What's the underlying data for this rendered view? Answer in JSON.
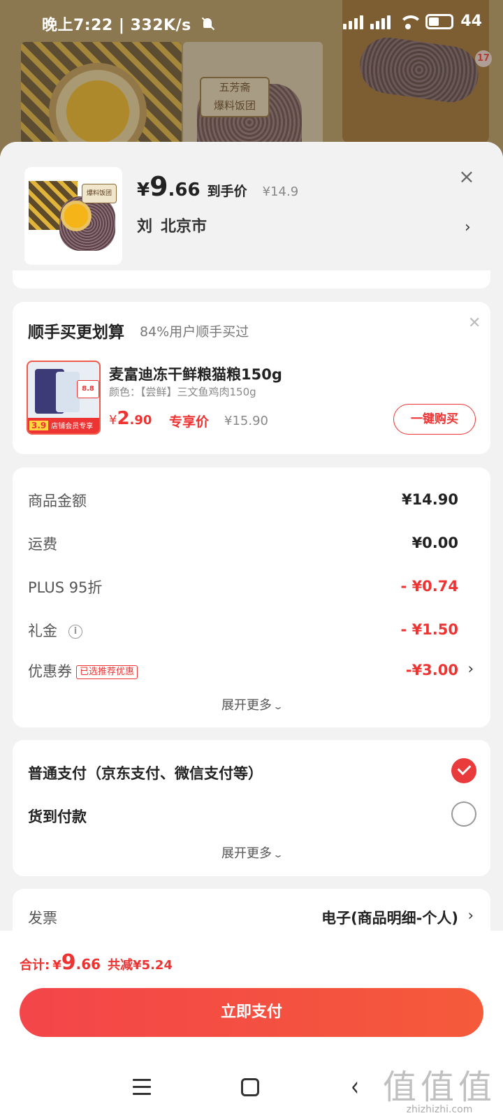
{
  "status_bar": {
    "time": "晚上7:22",
    "net_speed": "332K/s",
    "battery": "44"
  },
  "background": {
    "brand_text": "五芳斋",
    "product_name": "爆料饭团",
    "image_count": "17"
  },
  "product": {
    "price_symbol": "¥",
    "price_int": "9",
    "price_dec": ".66",
    "price_tag": "到手价",
    "original_price": "¥14.9",
    "recipient": "刘",
    "address": "北京市"
  },
  "upsell": {
    "title": "顺手买更划算",
    "subtitle": "84%用户顺手买过",
    "item_name": "麦富迪冻干鲜粮猫粮150g",
    "item_spec": "颜色：【尝鲜】三文鱼鸡肉150g",
    "price_symbol": "¥",
    "price_int": "2",
    "price_dec": ".90",
    "price_tag": "专享价",
    "original_price": "¥15.90",
    "buy_label": "一键购买",
    "image_badge": "8.8",
    "image_price": "3.9",
    "image_strip": "店铺会员专享"
  },
  "costs": {
    "rows": [
      {
        "label": "商品金额",
        "value": "¥14.90"
      },
      {
        "label": "运费",
        "value": "¥0.00"
      },
      {
        "label": "PLUS 95折",
        "value": "- ¥0.74"
      },
      {
        "label": "礼金",
        "value": "- ¥1.50"
      },
      {
        "label": "优惠券",
        "value": "-¥3.00",
        "badge": "已选推荐优惠"
      }
    ],
    "expand_label": "展开更多"
  },
  "payment": {
    "options": [
      {
        "label": "普通支付（京东支付、微信支付等）",
        "selected": true
      },
      {
        "label": "货到付款",
        "selected": false
      }
    ],
    "expand_label": "展开更多"
  },
  "invoice": {
    "label": "发票",
    "value": "电子(商品明细-个人)"
  },
  "bottom": {
    "total_label": "合计:",
    "total_symbol": "¥",
    "total_int": "9",
    "total_dec": ".66",
    "total_cut": "共减¥5.24",
    "pay_label": "立即支付"
  },
  "watermark": {
    "logo": "值值值",
    "site": "zhizhizhi.com"
  },
  "colors": {
    "accent_red": "#e93b3b",
    "pay_gradient_start": "#f3454a",
    "pay_gradient_end": "#f55a3a"
  }
}
